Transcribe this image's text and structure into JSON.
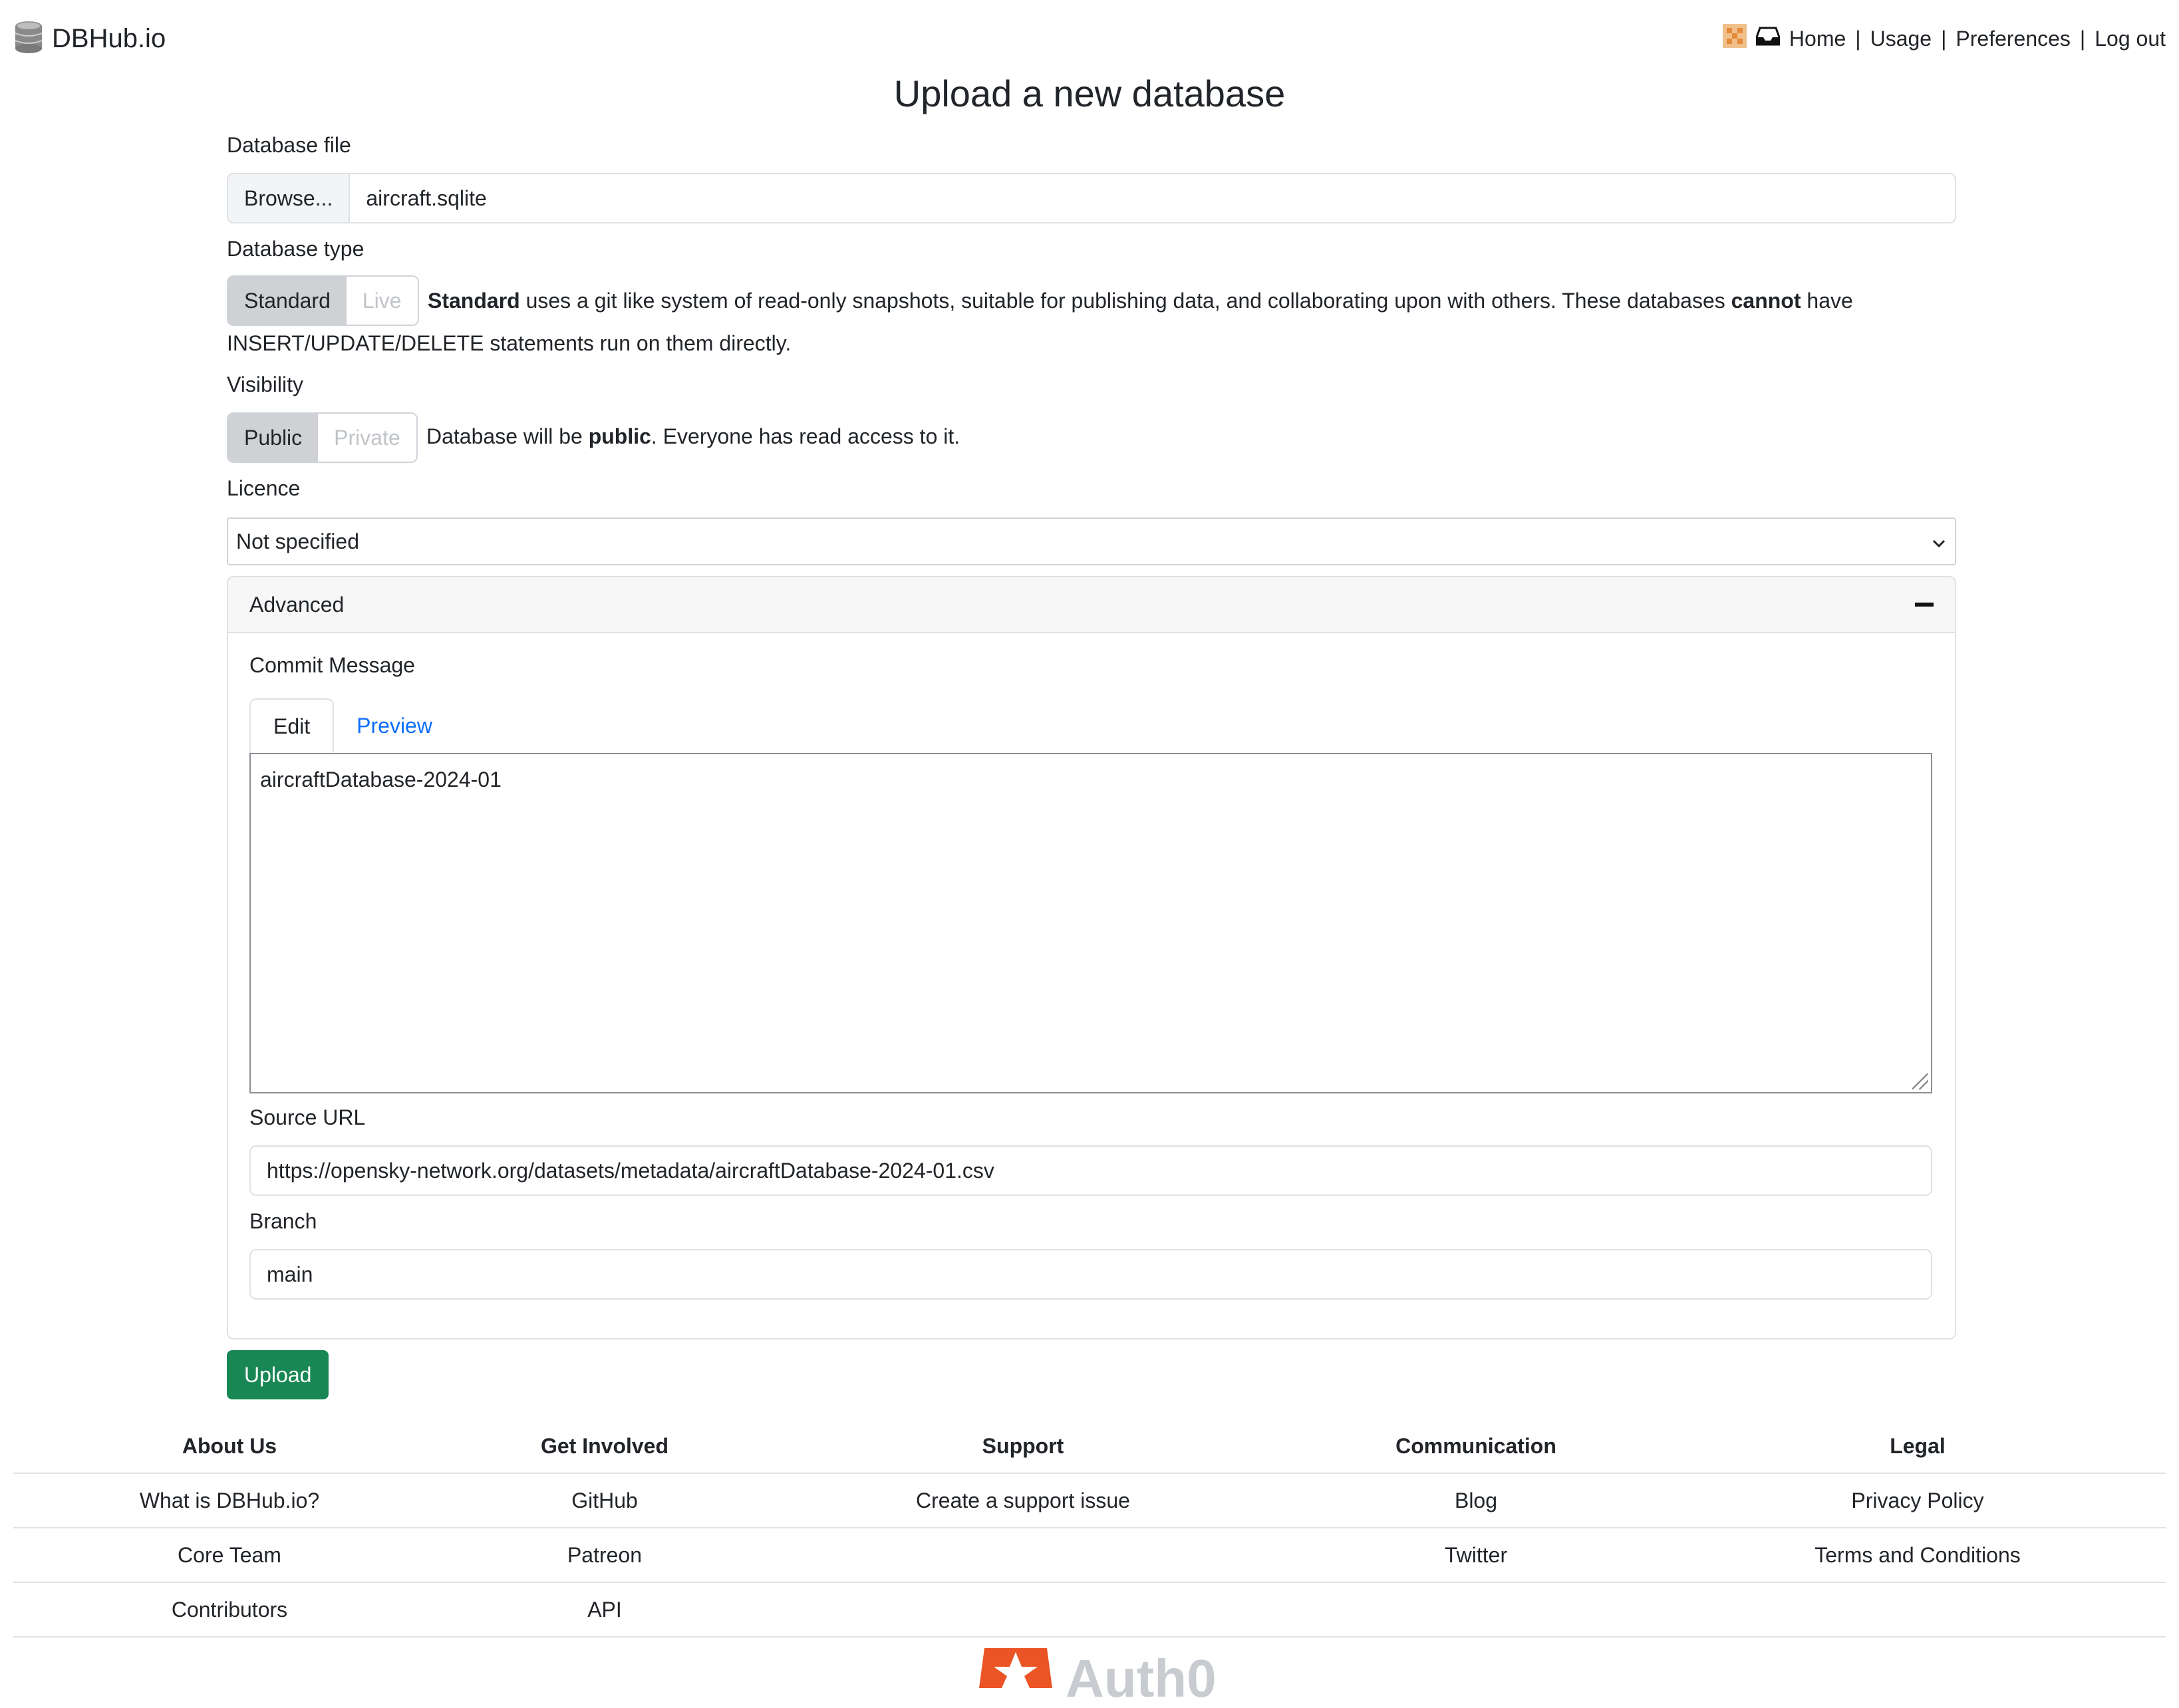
{
  "header": {
    "brand": "DBHub.io",
    "nav": [
      "Home",
      "Usage",
      "Preferences",
      "Log out"
    ],
    "separator": "|"
  },
  "page_title": "Upload a new database",
  "form": {
    "file_label": "Database file",
    "browse_label": "Browse...",
    "file_name": "aircraft.sqlite",
    "type_label": "Database type",
    "type_options": [
      "Standard",
      "Live"
    ],
    "type_selected": "Standard",
    "type_desc_bold": "Standard",
    "type_desc_1": " uses a git like system of read-only snapshots, suitable for publishing data, and collaborating upon with others. These databases ",
    "type_desc_bold2": "cannot",
    "type_desc_2": " have",
    "type_desc_3": "INSERT/UPDATE/DELETE statements run on them directly.",
    "visibility_label": "Visibility",
    "visibility_options": [
      "Public",
      "Private"
    ],
    "visibility_selected": "Public",
    "visibility_desc_1": "Database will be ",
    "visibility_desc_bold": "public",
    "visibility_desc_2": ". Everyone has read access to it.",
    "licence_label": "Licence",
    "licence_value": "Not specified",
    "advanced": {
      "title": "Advanced",
      "commit_label": "Commit Message",
      "tabs": [
        "Edit",
        "Preview"
      ],
      "commit_value": "aircraftDatabase-2024-01",
      "source_url_label": "Source URL",
      "source_url_value": "https://opensky-network.org/datasets/metadata/aircraftDatabase-2024-01.csv",
      "branch_label": "Branch",
      "branch_value": "main"
    },
    "upload_label": "Upload"
  },
  "footer": {
    "headers": [
      "About Us",
      "Get Involved",
      "Support",
      "Communication",
      "Legal"
    ],
    "rows": [
      [
        "What is DBHub.io?",
        "GitHub",
        "Create a support issue",
        "Blog",
        "Privacy Policy"
      ],
      [
        "Core Team",
        "Patreon",
        "",
        "Twitter",
        "Terms and Conditions"
      ],
      [
        "Contributors",
        "API",
        "",
        "",
        ""
      ]
    ],
    "sponsor": "Auth0"
  },
  "colors": {
    "upload_button": "#198754",
    "link": "#0d6efd",
    "auth0_orange": "#eb5424"
  }
}
